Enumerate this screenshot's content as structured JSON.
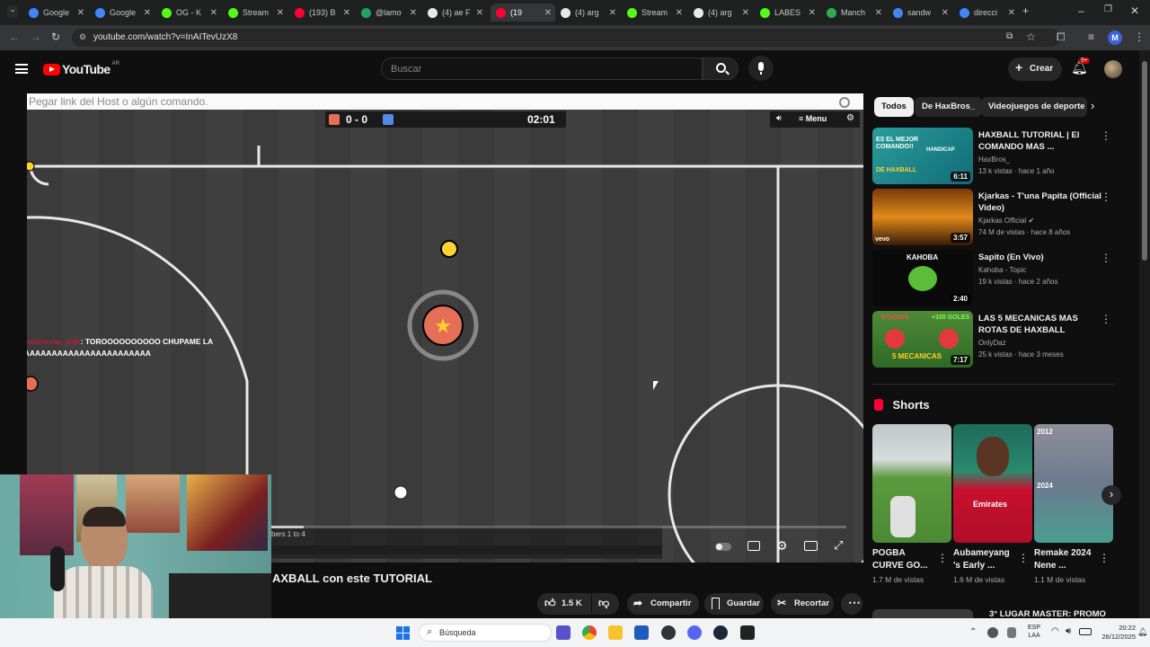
{
  "browser": {
    "tabs": [
      {
        "label": "Google",
        "color": "#4285f4"
      },
      {
        "label": "Google",
        "color": "#4285f4"
      },
      {
        "label": "OG - K",
        "color": "#53fc18"
      },
      {
        "label": "Stream",
        "color": "#53fc18"
      },
      {
        "label": "(193) B",
        "color": "#ff0033"
      },
      {
        "label": "@lamo",
        "color": "#1da462"
      },
      {
        "label": "(4) ae F",
        "color": "#e7e9ea"
      },
      {
        "label": "(19",
        "color": "#ff0033"
      },
      {
        "label": "(4) arg",
        "color": "#e7e9ea"
      },
      {
        "label": "Stream",
        "color": "#53fc18"
      },
      {
        "label": "(4) arg",
        "color": "#e7e9ea"
      },
      {
        "label": "LABES",
        "color": "#53fc18"
      },
      {
        "label": "Manch",
        "color": "#34a853"
      },
      {
        "label": "sandw",
        "color": "#4285f4"
      },
      {
        "label": "direcci",
        "color": "#4285f4"
      }
    ],
    "url": "youtube.com/watch?v=InAITevUzX8",
    "profile_initial": "M"
  },
  "youtube": {
    "logo_text": "YouTube",
    "country": "AR",
    "search_placeholder": "Buscar",
    "create_label": "Crear",
    "notif_count": "9+"
  },
  "player": {
    "chat_placeholder": "Pegar link del Host o algún comando.",
    "score": "0 - 0",
    "time": "02:01",
    "menu_label": "Menu",
    "chat_line1": ": TOROOOOOOOOOO CHUPAME LA",
    "chat_line2": "PIJAAAAAAAAAAAAAAAAAAAAAAA",
    "chat_user": "martinezaa_salk",
    "log_line1": "bers 1 to 4"
  },
  "video": {
    "title": "AXBALL con este TUTORIAL",
    "like_count": "1.5 K",
    "share_label": "Compartir",
    "save_label": "Guardar",
    "clip_label": "Recortar"
  },
  "sidebar": {
    "chips": [
      "Todos",
      "De HaxBros_",
      "Videojuegos de deporte"
    ],
    "recommendations": [
      {
        "title": "HAXBALL TUTORIAL | El COMANDO MAS ...",
        "channel": "HaxBros_",
        "stats": "13 k vistas · hace 1 año",
        "duration": "6:11",
        "thumb_text": "ES EL MEJOR COMANDO!!",
        "thumb_text2": "DE HAXBALL",
        "thumb_text3": "HANDICAP"
      },
      {
        "title": "Kjarkas - T'una Papita (Official Video)",
        "channel": "Kjarkas Official",
        "stats": "74 M de vistas · hace 8 años",
        "duration": "3:57",
        "thumb_text": "vevo"
      },
      {
        "title": "Sapito (En Vivo)",
        "channel": "Kahoba - Topic",
        "stats": "19 k vistas · hace 2 años",
        "duration": "2:40",
        "thumb_text": "KAHOBA"
      },
      {
        "title": "LAS 5 MECANICAS MAS ROTAS DE HAXBALL",
        "channel": "OnlyDaz",
        "stats": "25 k vistas · hace 3 meses",
        "duration": "7:17",
        "thumb_text": "5 MECANICAS",
        "thumb_text2": "0 GOLES",
        "thumb_text3": "+100 GOLES"
      }
    ],
    "shorts_label": "Shorts",
    "shorts": [
      {
        "title": "POGBA CURVE GO...",
        "views": "1.7 M de vistas"
      },
      {
        "title": "Aubameyang 's Early ...",
        "views": "1.6 M de vistas",
        "thumb_text": "Emirates"
      },
      {
        "title": "Remake 2024 Nene ...",
        "views": "1.1 M de vistas",
        "thumb_text": "2012",
        "thumb_text2": "2024"
      }
    ],
    "next_video_title": "3° LUGAR MASTER: PROMO"
  },
  "taskbar": {
    "search_label": "Búsqueda",
    "lang1": "ESP",
    "lang2": "LAA",
    "time": "20:22",
    "date": "26/12/2025"
  },
  "colors": {
    "yt_red": "#ff0000",
    "team_red": "#e56e56",
    "team_blue": "#5689e5",
    "field": "#3d3d3d"
  }
}
